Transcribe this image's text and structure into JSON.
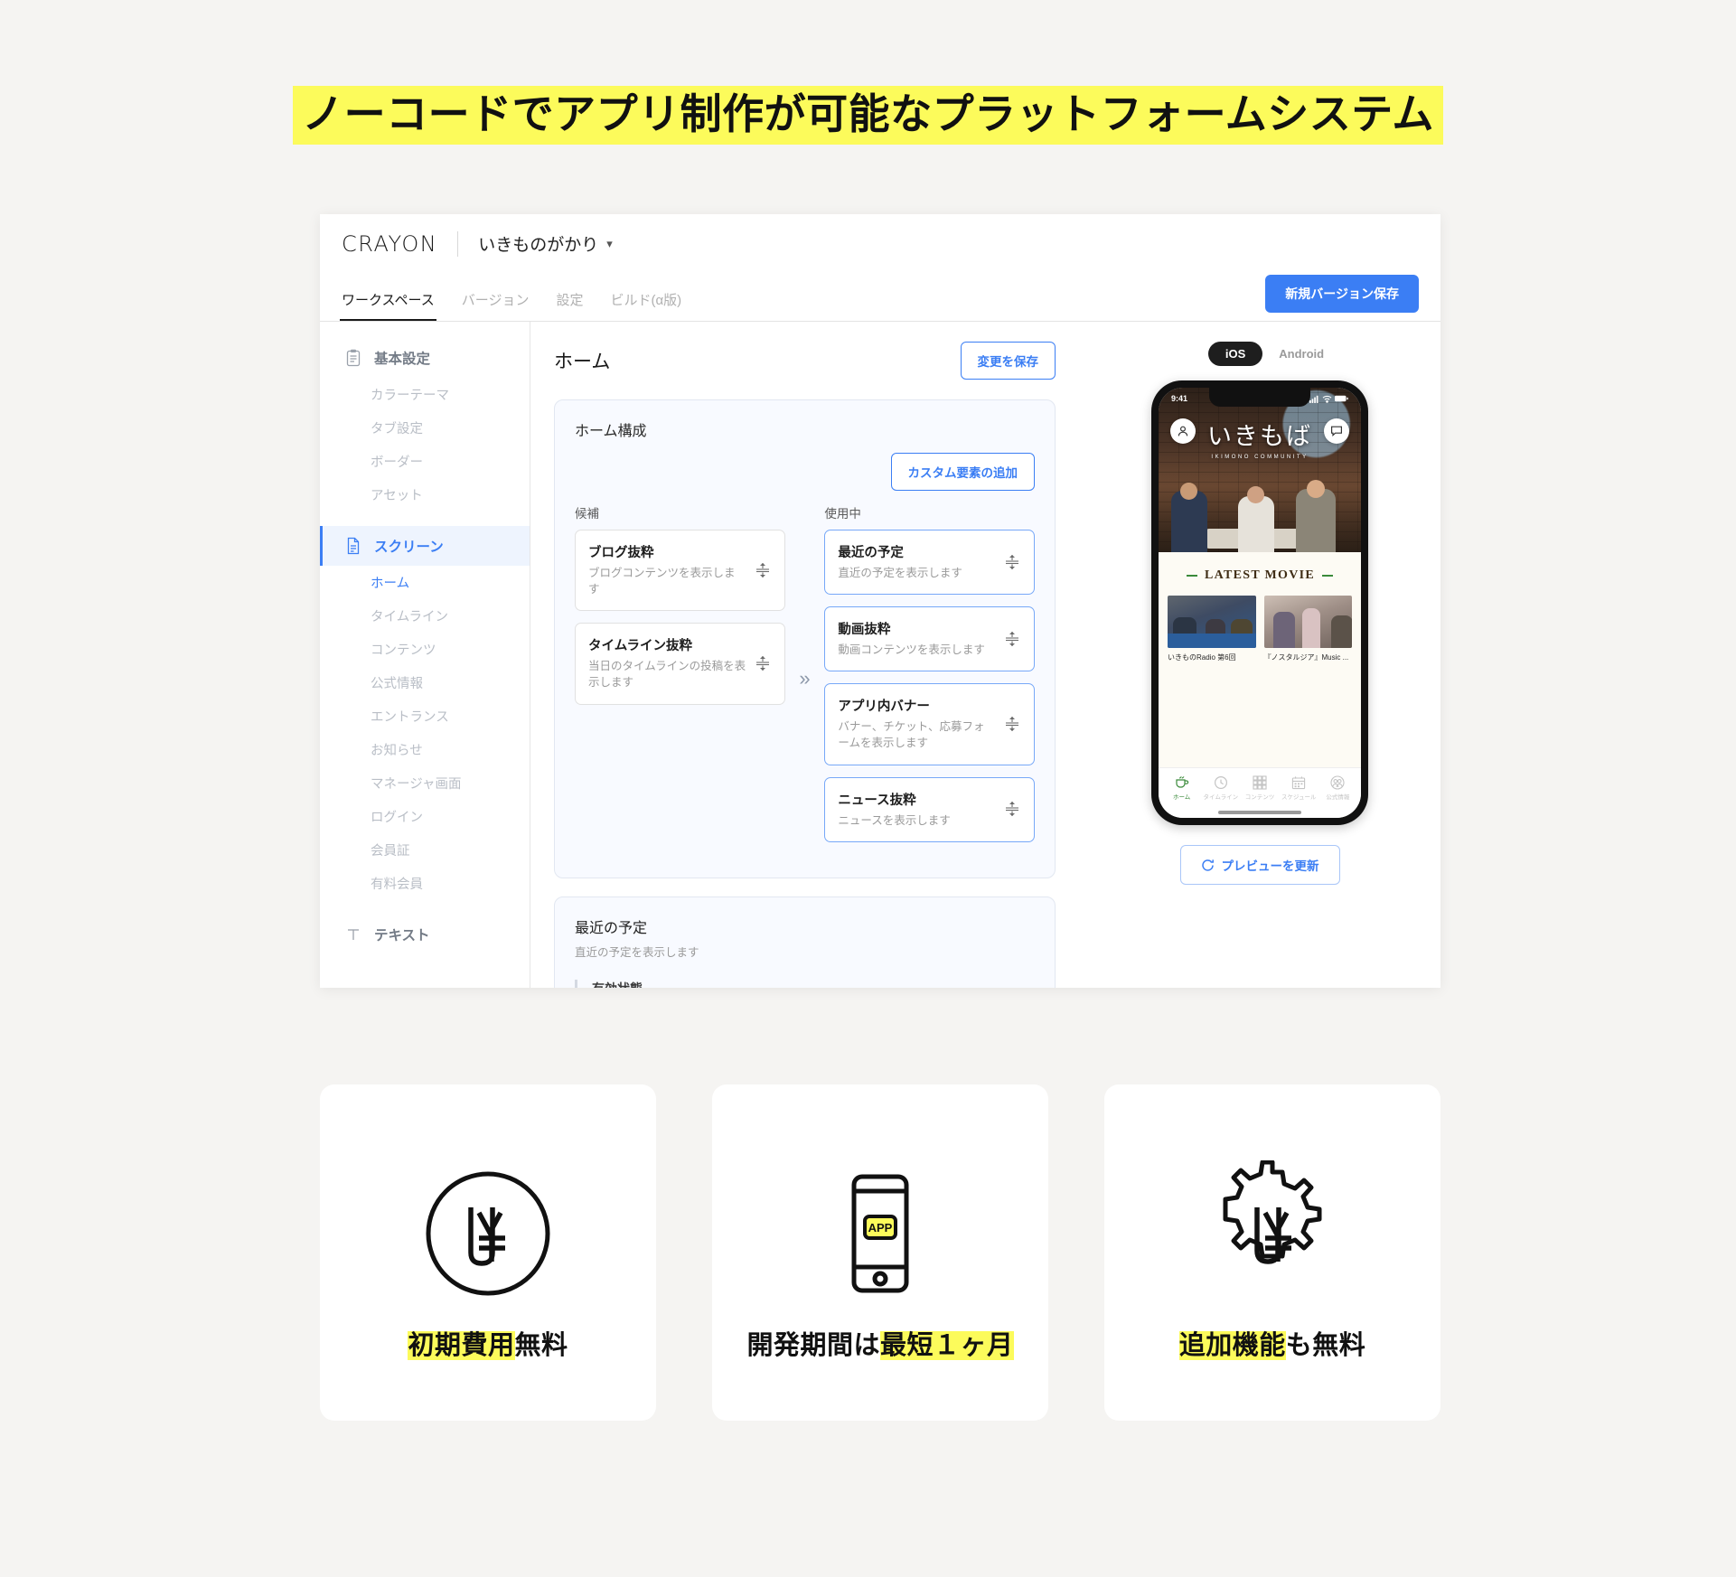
{
  "hero": {
    "title": "ノーコードでアプリ制作が可能なプラットフォームシステム",
    "highlight_color": "#fcfb5b"
  },
  "app": {
    "logo": "CRAYON",
    "workspace_name": "いきものがかり",
    "workspace_chevron": "chevron-down-icon",
    "accent_color": "#3b7ef4",
    "tabs": [
      {
        "label": "ワークスペース",
        "active": true
      },
      {
        "label": "バージョン",
        "active": false
      },
      {
        "label": "設定",
        "active": false
      },
      {
        "label": "ビルド(α版)",
        "active": false
      }
    ],
    "new_version_button": "新規バージョン保存"
  },
  "sidebar": {
    "groups": [
      {
        "label": "基本設定",
        "icon": "clipboard-icon",
        "active": false,
        "items": [
          {
            "label": "カラーテーマ",
            "active": false
          },
          {
            "label": "タブ設定",
            "active": false
          },
          {
            "label": "ボーダー",
            "active": false
          },
          {
            "label": "アセット",
            "active": false
          }
        ]
      },
      {
        "label": "スクリーン",
        "icon": "document-icon",
        "active": true,
        "items": [
          {
            "label": "ホーム",
            "active": true
          },
          {
            "label": "タイムライン",
            "active": false
          },
          {
            "label": "コンテンツ",
            "active": false
          },
          {
            "label": "公式情報",
            "active": false
          },
          {
            "label": "エントランス",
            "active": false
          },
          {
            "label": "お知らせ",
            "active": false
          },
          {
            "label": "マネージャ画面",
            "active": false
          },
          {
            "label": "ログイン",
            "active": false
          },
          {
            "label": "会員証",
            "active": false
          },
          {
            "label": "有料会員",
            "active": false
          }
        ]
      },
      {
        "label": "テキスト",
        "icon": "text-icon",
        "active": false,
        "items": []
      }
    ]
  },
  "main": {
    "page_title": "ホーム",
    "save_button": "変更を保存",
    "panel": {
      "title": "ホーム構成",
      "add_custom_button": "カスタム要素の追加",
      "candidates_label": "候補",
      "inuse_label": "使用中",
      "transfer_icon": "double-chevron-right-icon",
      "candidates": [
        {
          "name": "ブログ抜粋",
          "desc": "ブログコンテンツを表示します",
          "handle": "drag-handle-icon"
        },
        {
          "name": "タイムライン抜粋",
          "desc": "当日のタイムラインの投稿を表示します",
          "handle": "drag-handle-icon"
        }
      ],
      "in_use": [
        {
          "name": "最近の予定",
          "desc": "直近の予定を表示します",
          "handle": "drag-handle-icon"
        },
        {
          "name": "動画抜粋",
          "desc": "動画コンテンツを表示します",
          "handle": "drag-handle-icon"
        },
        {
          "name": "アプリ内バナー",
          "desc": "バナー、チケット、応募フォームを表示します",
          "handle": "drag-handle-icon"
        },
        {
          "name": "ニュース抜粋",
          "desc": "ニュースを表示します",
          "handle": "drag-handle-icon"
        }
      ]
    },
    "detail_panel": {
      "title": "最近の予定",
      "desc": "直近の予定を表示します",
      "field_label": "有効状態"
    }
  },
  "preview": {
    "os_options": [
      {
        "label": "iOS",
        "active": true
      },
      {
        "label": "Android",
        "active": false
      }
    ],
    "refresh_button": "プレビューを更新",
    "refresh_icon": "refresh-icon",
    "phone": {
      "status_time": "9:41",
      "status_icons": "signal-wifi-battery-icon",
      "profile_icon": "person-icon",
      "chat_icon": "chat-bubble-icon",
      "app_logo": "いきもば",
      "app_logo_sub": "IKIMONO COMMUNITY",
      "movie_section_title": "LATEST MOVIE",
      "movies": [
        {
          "caption": "いきものRadio 第6回"
        },
        {
          "caption": "『ノスタルジア』Music ..."
        }
      ],
      "tabbar": [
        {
          "label": "ホーム",
          "icon": "coffee-cup-icon",
          "active": true
        },
        {
          "label": "タイムライン",
          "icon": "clock-icon",
          "active": false
        },
        {
          "label": "コンテンツ",
          "icon": "grid-icon",
          "active": false
        },
        {
          "label": "スケジュール",
          "icon": "calendar-icon",
          "active": false
        },
        {
          "label": "公式情報",
          "icon": "group-icon",
          "active": false
        }
      ]
    }
  },
  "features": [
    {
      "icon": "yen-coin-icon",
      "label_highlight": "初期費用",
      "label_plain": "無料",
      "highlight_first": true
    },
    {
      "icon": "smartphone-app-icon",
      "label_pre": "開発期間は",
      "label_highlight": "最短１ヶ月",
      "label_plain": "",
      "highlight_first": false
    },
    {
      "icon": "gear-yen-icon",
      "label_highlight": "追加機能",
      "label_plain": "も無料",
      "highlight_first": true
    }
  ]
}
